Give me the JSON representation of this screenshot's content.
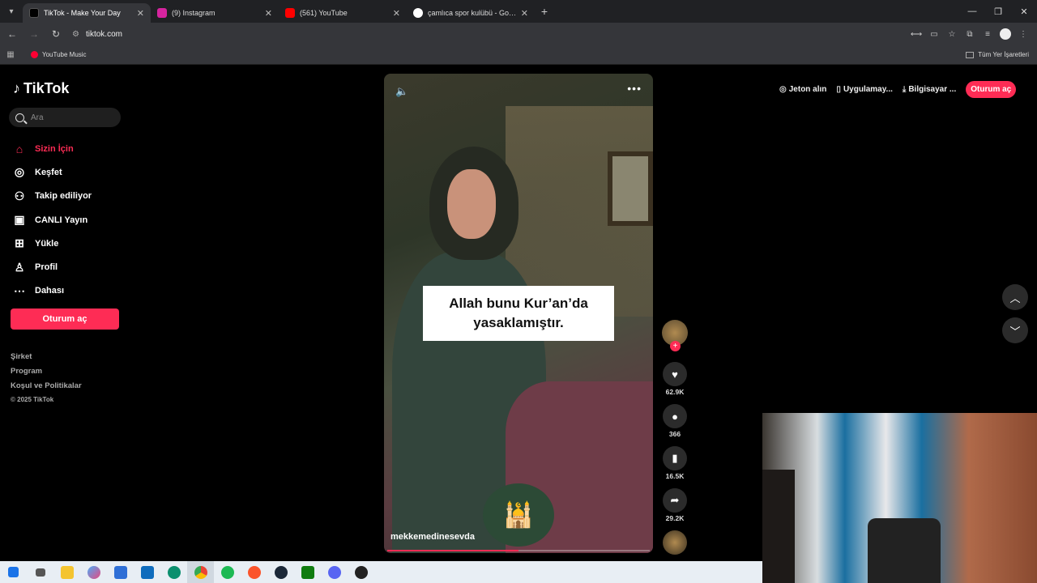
{
  "browser": {
    "tabs": [
      {
        "label": "TikTok - Make Your Day",
        "favicon_color": "#000000",
        "active": true
      },
      {
        "label": "(9) Instagram",
        "favicon_color": "#d6249f",
        "active": false
      },
      {
        "label": "(561) YouTube",
        "favicon_color": "#ff0000",
        "active": false
      },
      {
        "label": "çamlıca spor kulübü - Google'da",
        "favicon_color": "#4285f4",
        "active": false
      }
    ],
    "url": "tiktok.com",
    "bookmarks": [
      {
        "label": "YouTube Music"
      }
    ],
    "bookmarks_right": "Tüm Yer İşaretleri"
  },
  "sidebar": {
    "logo": "TikTok",
    "search_placeholder": "Ara",
    "nav": [
      {
        "label": "Sizin İçin",
        "icon": "home-icon",
        "active": true
      },
      {
        "label": "Keşfet",
        "icon": "compass-icon",
        "active": false
      },
      {
        "label": "Takip ediliyor",
        "icon": "user-follow-icon",
        "active": false
      },
      {
        "label": "CANLI Yayın",
        "icon": "live-tv-icon",
        "active": false
      },
      {
        "label": "Yükle",
        "icon": "upload-icon",
        "active": false
      },
      {
        "label": "Profil",
        "icon": "profile-icon",
        "active": false
      },
      {
        "label": "Dahası",
        "icon": "more-icon",
        "active": false
      }
    ],
    "login_button": "Oturum aç",
    "footer": [
      "Şirket",
      "Program",
      "Koşul ve Politikalar"
    ],
    "copyright": "© 2025 TikTok"
  },
  "video": {
    "caption": "Allah bunu Kur’an’da yasaklamıştır.",
    "username": "mekkemedinesevda",
    "progress": 0.5
  },
  "actions": {
    "likes": "62.9K",
    "comments": "366",
    "saves": "16.5K",
    "shares": "29.2K"
  },
  "topbar": {
    "coins": "Jeton alın",
    "app": "Uygulamay...",
    "desktop": "Bilgisayar ...",
    "login": "Oturum aç"
  },
  "colors": {
    "accent": "#fe2c55"
  }
}
